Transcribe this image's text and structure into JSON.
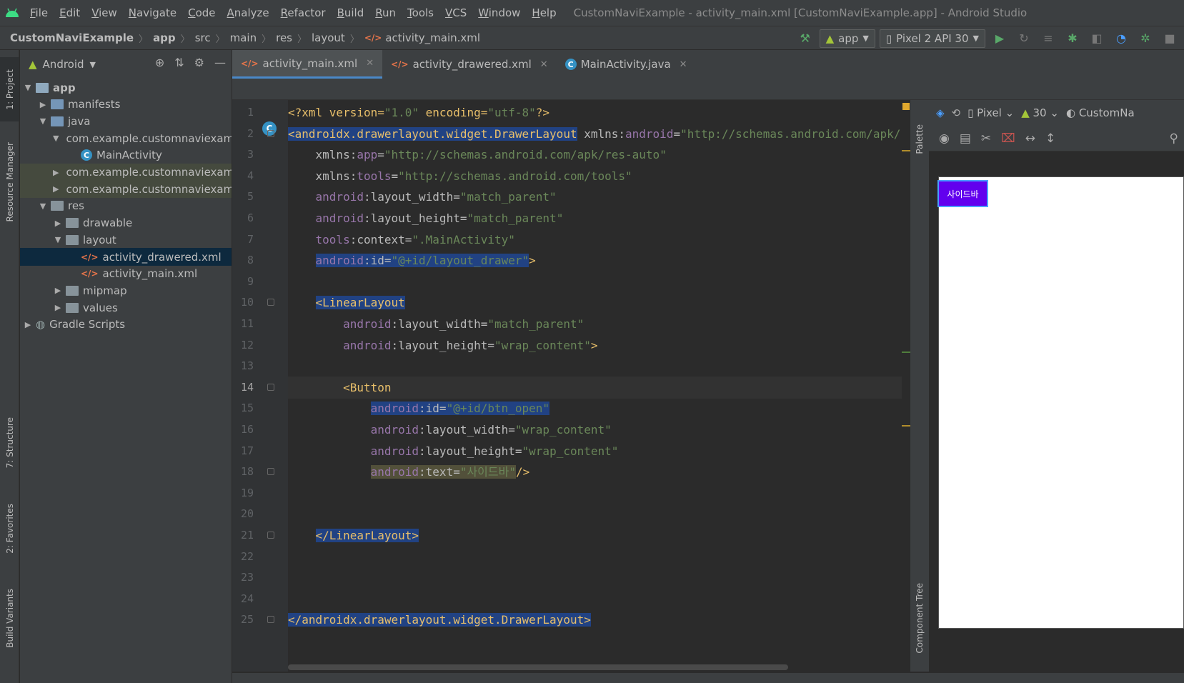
{
  "window": {
    "title": "CustomNaviExample - activity_main.xml [CustomNaviExample.app] - Android Studio"
  },
  "menu": [
    "File",
    "Edit",
    "View",
    "Navigate",
    "Code",
    "Analyze",
    "Refactor",
    "Build",
    "Run",
    "Tools",
    "VCS",
    "Window",
    "Help"
  ],
  "breadcrumb": [
    "CustomNaviExample",
    "app",
    "src",
    "main",
    "res",
    "layout",
    "activity_main.xml"
  ],
  "run_config": {
    "module": "app",
    "device": "Pixel 2 API 30"
  },
  "left_strip": [
    "1: Project",
    "Resource Manager",
    "7: Structure",
    "2: Favorites",
    "Build Variants"
  ],
  "project": {
    "view_mode": "Android",
    "tree": [
      {
        "label": "app",
        "indent": 0,
        "arrow": "▼",
        "icon": "module",
        "bold": true
      },
      {
        "label": "manifests",
        "indent": 1,
        "arrow": "▶",
        "icon": "folder-blue"
      },
      {
        "label": "java",
        "indent": 1,
        "arrow": "▼",
        "icon": "folder-blue"
      },
      {
        "label": "com.example.customnaviexam",
        "indent": 2,
        "arrow": "▼",
        "icon": "folder"
      },
      {
        "label": "MainActivity",
        "indent": 3,
        "arrow": "",
        "icon": "class"
      },
      {
        "label": "com.example.customnaviexam",
        "indent": 2,
        "arrow": "▶",
        "icon": "folder",
        "hl": true
      },
      {
        "label": "com.example.customnaviexam",
        "indent": 2,
        "arrow": "▶",
        "icon": "folder",
        "hl": true
      },
      {
        "label": "res",
        "indent": 1,
        "arrow": "▼",
        "icon": "folder"
      },
      {
        "label": "drawable",
        "indent": 2,
        "arrow": "▶",
        "icon": "folder"
      },
      {
        "label": "layout",
        "indent": 2,
        "arrow": "▼",
        "icon": "folder"
      },
      {
        "label": "activity_drawered.xml",
        "indent": 3,
        "arrow": "",
        "icon": "xml",
        "selected": true
      },
      {
        "label": "activity_main.xml",
        "indent": 3,
        "arrow": "",
        "icon": "xml"
      },
      {
        "label": "mipmap",
        "indent": 2,
        "arrow": "▶",
        "icon": "folder"
      },
      {
        "label": "values",
        "indent": 2,
        "arrow": "▶",
        "icon": "folder"
      },
      {
        "label": "Gradle Scripts",
        "indent": 0,
        "arrow": "▶",
        "icon": "gradle"
      }
    ]
  },
  "tabs": [
    {
      "label": "activity_main.xml",
      "icon": "xml",
      "active": true
    },
    {
      "label": "activity_drawered.xml",
      "icon": "xml",
      "active": false
    },
    {
      "label": "MainActivity.java",
      "icon": "class",
      "active": false
    }
  ],
  "editor": {
    "current_line": 14,
    "lines": [
      [
        {
          "t": "<?xml version=",
          "c": "tag"
        },
        {
          "t": "\"1.0\"",
          "c": "val"
        },
        {
          "t": " encoding=",
          "c": "tag"
        },
        {
          "t": "\"utf-8\"",
          "c": "val"
        },
        {
          "t": "?>",
          "c": "tag"
        }
      ],
      [
        {
          "t": "<androidx.drawerlayout.widget.DrawerLayout",
          "c": "tag",
          "sel": true
        },
        {
          "t": " xmlns:",
          "c": "attr"
        },
        {
          "t": "android",
          "c": "ns"
        },
        {
          "t": "=",
          "c": "attr"
        },
        {
          "t": "\"http://schemas.android.com/apk/res/android\"",
          "c": "val"
        }
      ],
      [
        {
          "t": "    xmlns:",
          "c": "attr"
        },
        {
          "t": "app",
          "c": "ns"
        },
        {
          "t": "=",
          "c": "attr"
        },
        {
          "t": "\"http://schemas.android.com/apk/res-auto\"",
          "c": "val"
        }
      ],
      [
        {
          "t": "    xmlns:",
          "c": "attr"
        },
        {
          "t": "tools",
          "c": "ns"
        },
        {
          "t": "=",
          "c": "attr"
        },
        {
          "t": "\"http://schemas.android.com/tools\"",
          "c": "val"
        }
      ],
      [
        {
          "t": "    android",
          "c": "ns"
        },
        {
          "t": ":layout_width=",
          "c": "attr"
        },
        {
          "t": "\"match_parent\"",
          "c": "val"
        }
      ],
      [
        {
          "t": "    android",
          "c": "ns"
        },
        {
          "t": ":layout_height=",
          "c": "attr"
        },
        {
          "t": "\"match_parent\"",
          "c": "val"
        }
      ],
      [
        {
          "t": "    tools",
          "c": "ns"
        },
        {
          "t": ":context=",
          "c": "attr"
        },
        {
          "t": "\".MainActivity\"",
          "c": "val"
        }
      ],
      [
        {
          "t": "    ",
          "c": "pl"
        },
        {
          "t": "android",
          "c": "ns",
          "sel": true
        },
        {
          "t": ":id=",
          "c": "attr",
          "sel": true
        },
        {
          "t": "\"@+id/layout_drawer\"",
          "c": "val",
          "sel": true
        },
        {
          "t": ">",
          "c": "tag"
        }
      ],
      [],
      [
        {
          "t": "    ",
          "c": "pl"
        },
        {
          "t": "<LinearLayout",
          "c": "tag",
          "sel": true
        }
      ],
      [
        {
          "t": "        android",
          "c": "ns"
        },
        {
          "t": ":layout_width=",
          "c": "attr"
        },
        {
          "t": "\"match_parent\"",
          "c": "val"
        }
      ],
      [
        {
          "t": "        android",
          "c": "ns"
        },
        {
          "t": ":layout_height=",
          "c": "attr"
        },
        {
          "t": "\"wrap_content\"",
          "c": "val"
        },
        {
          "t": ">",
          "c": "tag"
        }
      ],
      [],
      [
        {
          "t": "        ",
          "c": "pl"
        },
        {
          "t": "<Button",
          "c": "tag"
        }
      ],
      [
        {
          "t": "            ",
          "c": "pl"
        },
        {
          "t": "android",
          "c": "ns",
          "sel": true
        },
        {
          "t": ":id=",
          "c": "attr",
          "sel": true
        },
        {
          "t": "\"@+id/btn_open\"",
          "c": "val",
          "sel": true
        }
      ],
      [
        {
          "t": "            android",
          "c": "ns"
        },
        {
          "t": ":layout_width=",
          "c": "attr"
        },
        {
          "t": "\"wrap_content\"",
          "c": "val"
        }
      ],
      [
        {
          "t": "            android",
          "c": "ns"
        },
        {
          "t": ":layout_height=",
          "c": "attr"
        },
        {
          "t": "\"wrap_content\"",
          "c": "val"
        }
      ],
      [
        {
          "t": "            ",
          "c": "pl"
        },
        {
          "t": "android",
          "c": "ns",
          "yel": true
        },
        {
          "t": ":text=",
          "c": "attr",
          "yel": true
        },
        {
          "t": "\"사이드바\"",
          "c": "val",
          "yel": true
        },
        {
          "t": "/>",
          "c": "tag"
        }
      ],
      [],
      [],
      [
        {
          "t": "    ",
          "c": "pl"
        },
        {
          "t": "</LinearLayout>",
          "c": "tag",
          "sel": true
        }
      ],
      [],
      [],
      [],
      [
        {
          "t": "</androidx.drawerlayout.widget.DrawerLayout>",
          "c": "tag",
          "sel": true
        }
      ]
    ]
  },
  "design": {
    "device": "Pixel",
    "api": "30",
    "theme": "CustomNa",
    "palette_label": "Palette",
    "component_tree_label": "Component Tree",
    "preview_button_text": "사이드바"
  },
  "colors": {
    "accent": "#4a88c7",
    "button": "#6200ee",
    "android_green": "#a4c639"
  }
}
